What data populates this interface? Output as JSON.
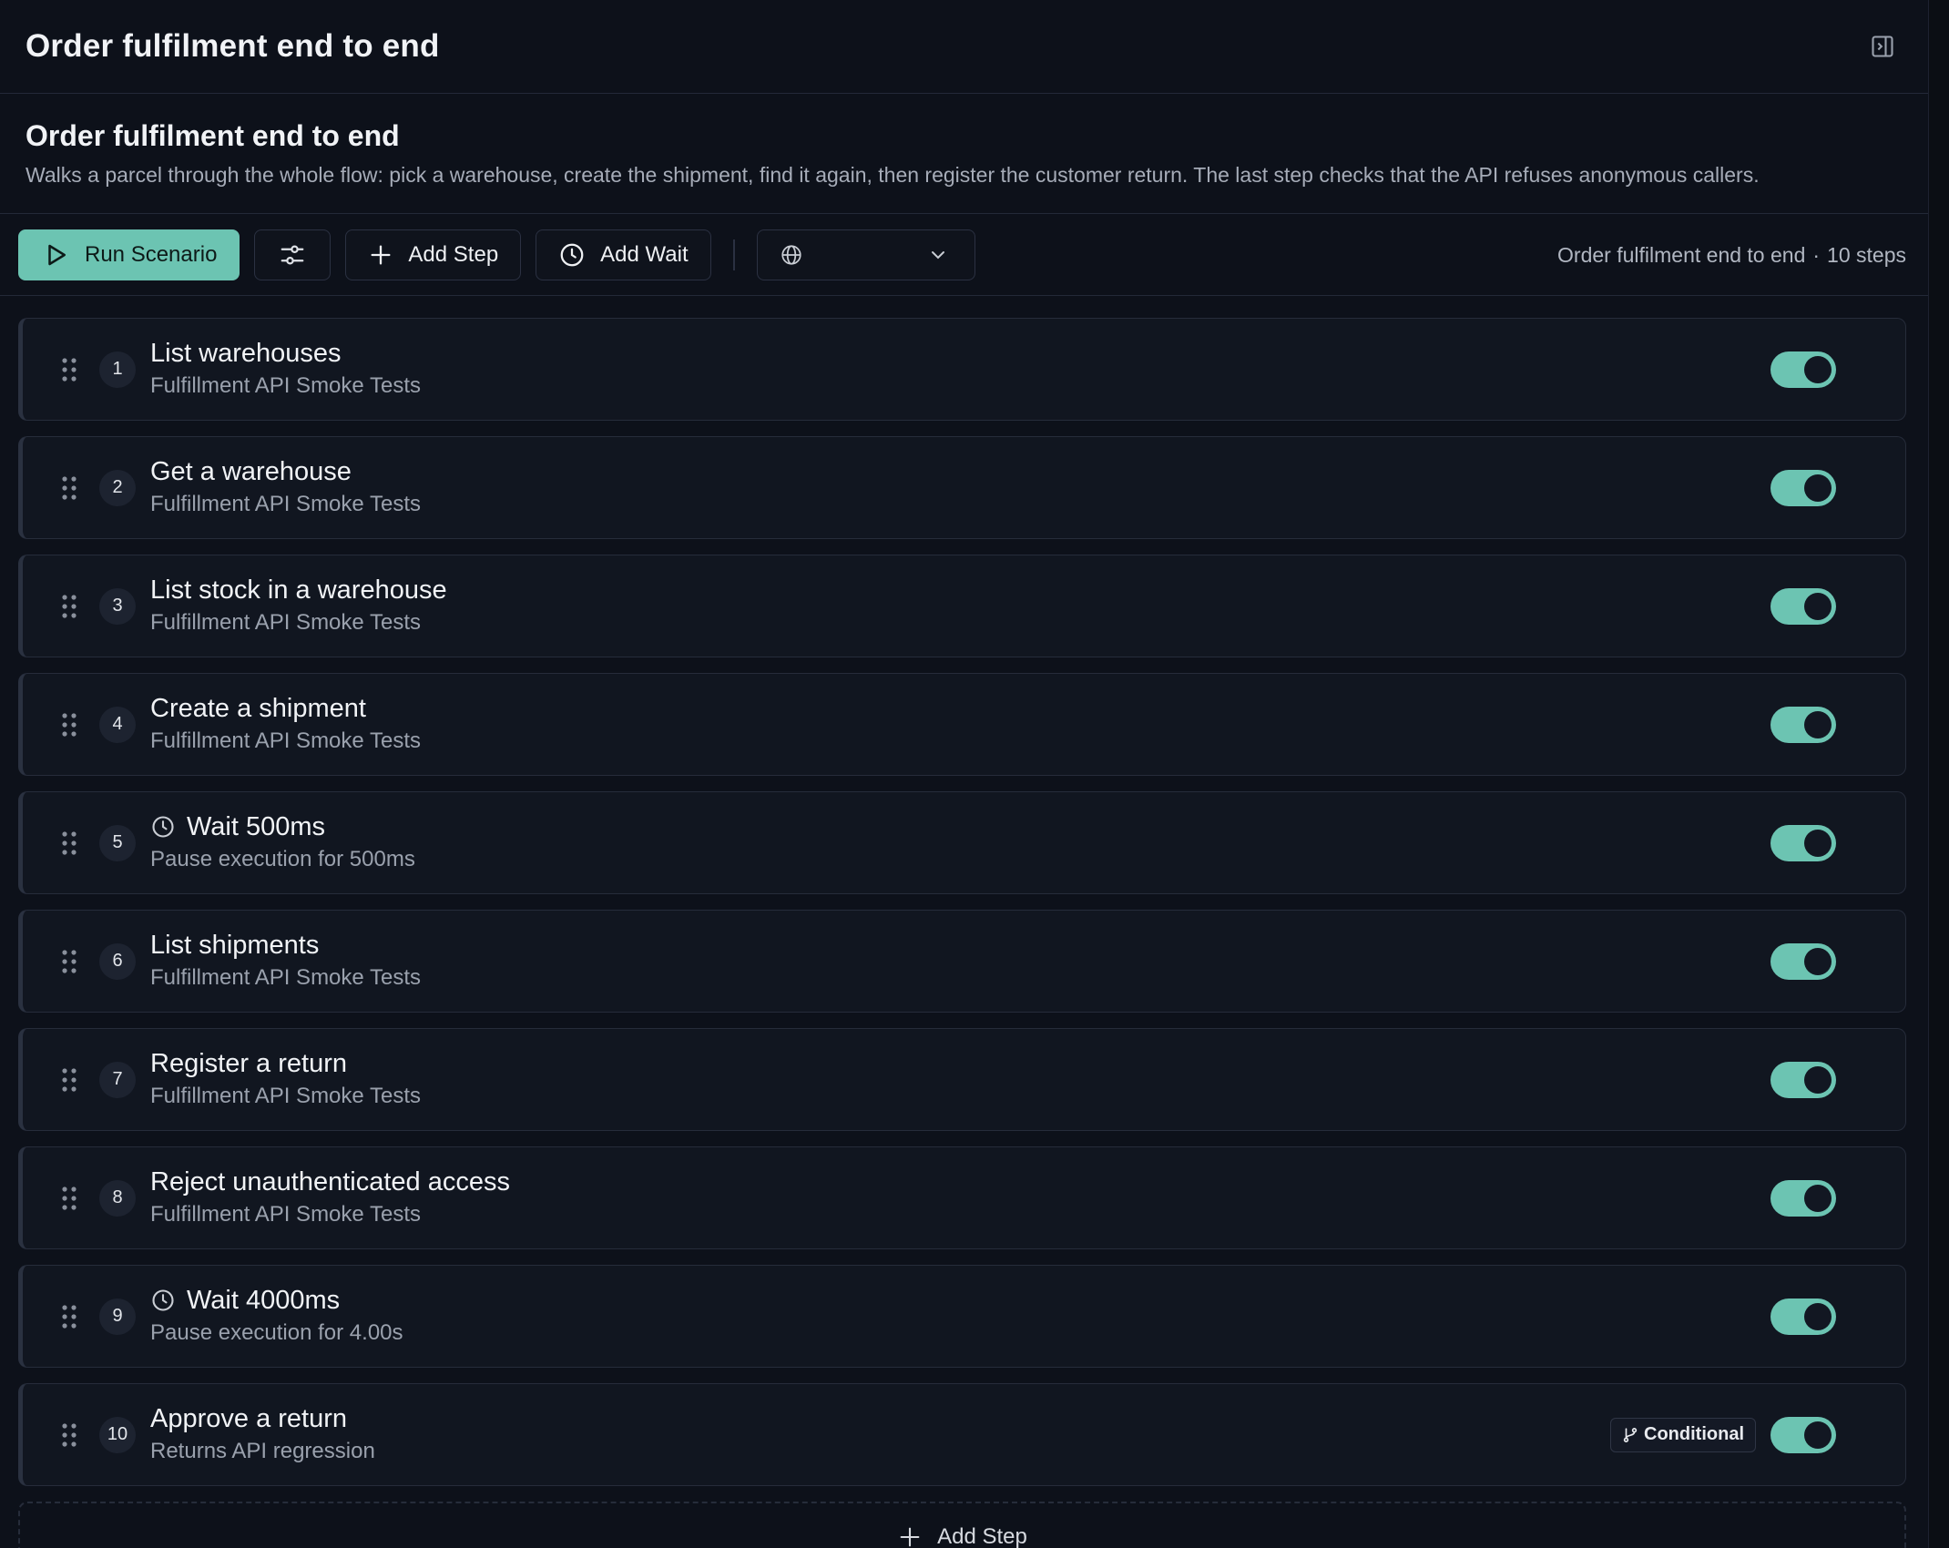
{
  "header": {
    "title": "Order fulfilment end to end",
    "panel_toggle_icon": "panel-right-icon"
  },
  "description": {
    "heading": "Order fulfilment end to end",
    "text": "Walks a parcel through the whole flow: pick a warehouse, create the shipment, find it again, then register the customer return. The last step checks that the API refuses anonymous callers."
  },
  "toolbar": {
    "run_label": "Run Scenario",
    "settings_icon": "sliders-icon",
    "add_step_label": "Add Step",
    "add_wait_label": "Add Wait",
    "environment_value": "",
    "summary_name": "Order fulfilment end to end",
    "summary_separator": "·",
    "summary_count": "10 steps"
  },
  "colors": {
    "accent": "#6cc4b2",
    "background": "#0d111a",
    "card": "#111620"
  },
  "steps": [
    {
      "number": "1",
      "title": "List warehouses",
      "subtitle": "Fulfillment API Smoke Tests",
      "is_wait": false,
      "enabled": true,
      "badge": ""
    },
    {
      "number": "2",
      "title": "Get a warehouse",
      "subtitle": "Fulfillment API Smoke Tests",
      "is_wait": false,
      "enabled": true,
      "badge": ""
    },
    {
      "number": "3",
      "title": "List stock in a warehouse",
      "subtitle": "Fulfillment API Smoke Tests",
      "is_wait": false,
      "enabled": true,
      "badge": ""
    },
    {
      "number": "4",
      "title": "Create a shipment",
      "subtitle": "Fulfillment API Smoke Tests",
      "is_wait": false,
      "enabled": true,
      "badge": ""
    },
    {
      "number": "5",
      "title": "Wait 500ms",
      "subtitle": "Pause execution for 500ms",
      "is_wait": true,
      "enabled": true,
      "badge": ""
    },
    {
      "number": "6",
      "title": "List shipments",
      "subtitle": "Fulfillment API Smoke Tests",
      "is_wait": false,
      "enabled": true,
      "badge": ""
    },
    {
      "number": "7",
      "title": "Register a return",
      "subtitle": "Fulfillment API Smoke Tests",
      "is_wait": false,
      "enabled": true,
      "badge": ""
    },
    {
      "number": "8",
      "title": "Reject unauthenticated access",
      "subtitle": "Fulfillment API Smoke Tests",
      "is_wait": false,
      "enabled": true,
      "badge": ""
    },
    {
      "number": "9",
      "title": "Wait 4000ms",
      "subtitle": "Pause execution for 4.00s",
      "is_wait": true,
      "enabled": true,
      "badge": ""
    },
    {
      "number": "10",
      "title": "Approve a return",
      "subtitle": "Returns API regression",
      "is_wait": false,
      "enabled": true,
      "badge": "Conditional"
    }
  ],
  "footer": {
    "add_step_label": "Add Step"
  }
}
